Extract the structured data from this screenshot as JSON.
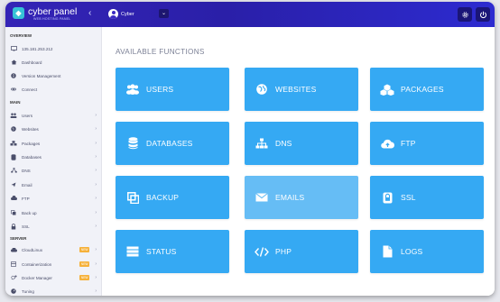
{
  "header": {
    "app_title": "cyber panel",
    "tagline": "WEB HOSTING PANEL",
    "collapse_icon": "‹",
    "user_name": "Cyber",
    "dropdown_icon": "⌄"
  },
  "sidebar": {
    "overview_label": "OVERVIEW",
    "ip_address": "135.181.253.212",
    "dashboard": "Dashboard",
    "version": "Version Management",
    "connect": "Connect",
    "main_label": "MAIN",
    "users": "Users",
    "websites": "Websites",
    "packages": "Packages",
    "databases": "Databases",
    "dns": "DNS",
    "email": "Email",
    "ftp": "FTP",
    "backup": "Back up",
    "ssl": "SSL",
    "server_label": "SERVER",
    "cloudlinux": "CloudLinux",
    "containerization": "Containerization",
    "docker": "Docker Manager",
    "tuning": "Tuning",
    "new_badge": "NEW"
  },
  "main": {
    "title": "AVAILABLE FUNCTIONS",
    "tiles": {
      "users": "USERS",
      "websites": "WEBSITES",
      "packages": "PACKAGES",
      "databases": "DATABASES",
      "dns": "DNS",
      "ftp": "FTP",
      "backup": "BACKUP",
      "emails": "EMAILS",
      "ssl": "SSL",
      "status": "STATUS",
      "php": "PHP",
      "logs": "LOGS"
    }
  },
  "colors": {
    "header": "#3424b6",
    "tile": "#35a9f3",
    "tile_hover": "#66bdf5",
    "sidebar_bg": "#f1f2f8",
    "badge": "#f6b13a"
  }
}
